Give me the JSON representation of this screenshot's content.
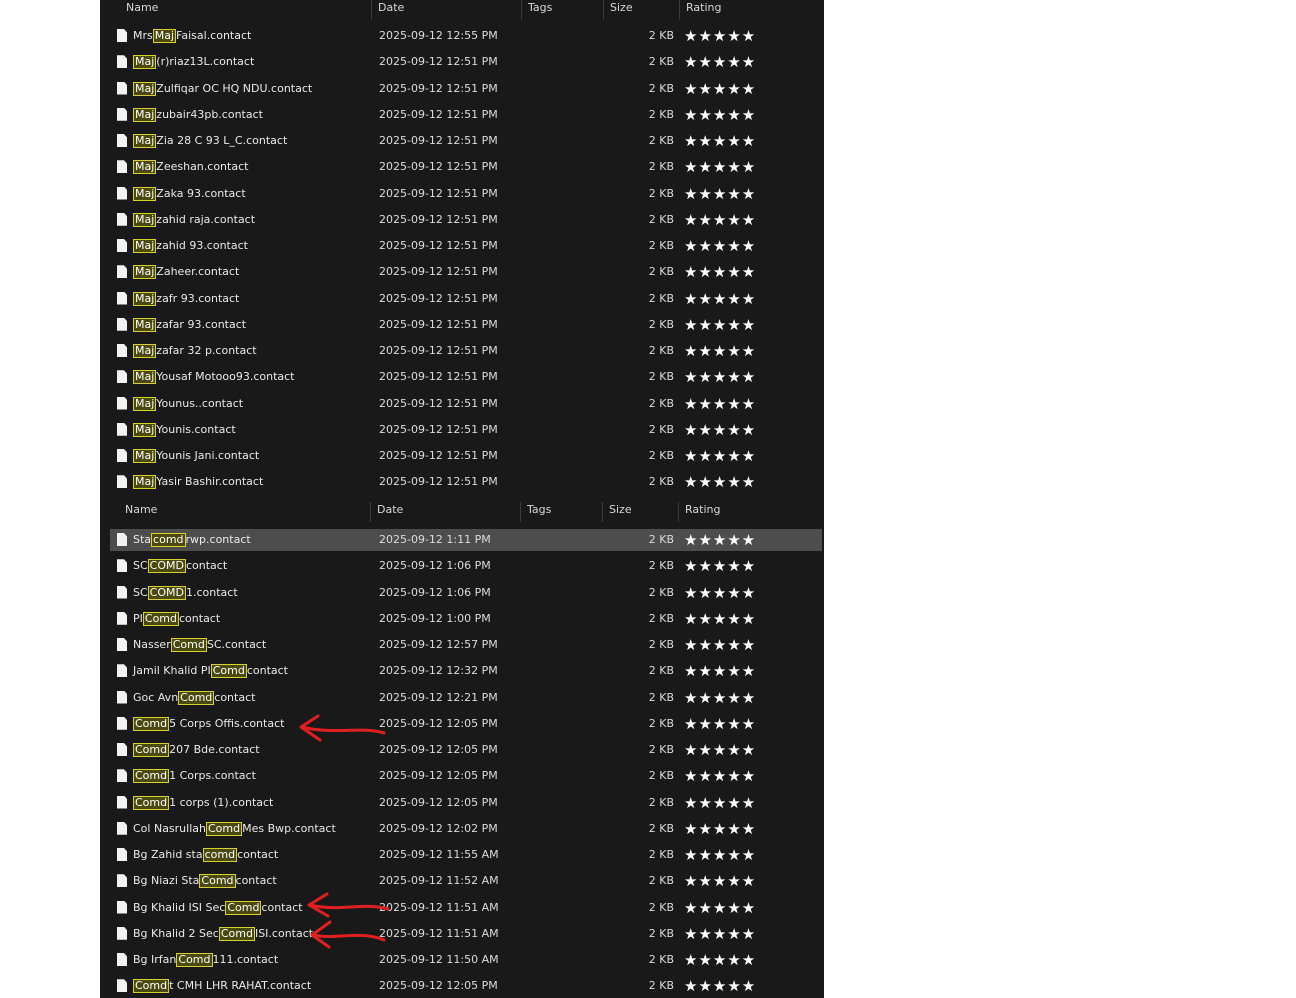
{
  "columns": {
    "name": "Name",
    "date": "Date",
    "tags": "Tags",
    "size": "Size",
    "rating": "Rating"
  },
  "colors": {
    "highlight_border": "#d8d130",
    "highlight_bg": "#4a4a10",
    "annotation_arrow": "#e02020",
    "panel_bg": "#191919"
  },
  "icons": {
    "file": "file-icon",
    "star": "star-icon"
  },
  "top_list": {
    "rows": [
      {
        "pre": "Mrs",
        "hl": "Maj",
        "post": "Faisal.contact",
        "date": "2025-09-12 12:55 PM",
        "size": "2 KB",
        "rating": "★★★★★"
      },
      {
        "pre": "",
        "hl": "Maj",
        "post": "(r)riaz13L.contact",
        "date": "2025-09-12 12:51 PM",
        "size": "2 KB",
        "rating": "★★★★★"
      },
      {
        "pre": "",
        "hl": "Maj",
        "post": "Zulfiqar OC HQ NDU.contact",
        "date": "2025-09-12 12:51 PM",
        "size": "2 KB",
        "rating": "★★★★★"
      },
      {
        "pre": "",
        "hl": "Maj",
        "post": "zubair43pb.contact",
        "date": "2025-09-12 12:51 PM",
        "size": "2 KB",
        "rating": "★★★★★"
      },
      {
        "pre": "",
        "hl": "Maj",
        "post": "Zia 28 C 93 L_C.contact",
        "date": "2025-09-12 12:51 PM",
        "size": "2 KB",
        "rating": "★★★★★"
      },
      {
        "pre": "",
        "hl": "Maj",
        "post": "Zeeshan.contact",
        "date": "2025-09-12 12:51 PM",
        "size": "2 KB",
        "rating": "★★★★★"
      },
      {
        "pre": "",
        "hl": "Maj",
        "post": "Zaka 93.contact",
        "date": "2025-09-12 12:51 PM",
        "size": "2 KB",
        "rating": "★★★★★"
      },
      {
        "pre": "",
        "hl": "Maj",
        "post": "zahid raja.contact",
        "date": "2025-09-12 12:51 PM",
        "size": "2 KB",
        "rating": "★★★★★"
      },
      {
        "pre": "",
        "hl": "Maj",
        "post": "zahid 93.contact",
        "date": "2025-09-12 12:51 PM",
        "size": "2 KB",
        "rating": "★★★★★"
      },
      {
        "pre": "",
        "hl": "Maj",
        "post": "Zaheer.contact",
        "date": "2025-09-12 12:51 PM",
        "size": "2 KB",
        "rating": "★★★★★"
      },
      {
        "pre": "",
        "hl": "Maj",
        "post": "zafr 93.contact",
        "date": "2025-09-12 12:51 PM",
        "size": "2 KB",
        "rating": "★★★★★"
      },
      {
        "pre": "",
        "hl": "Maj",
        "post": "zafar 93.contact",
        "date": "2025-09-12 12:51 PM",
        "size": "2 KB",
        "rating": "★★★★★"
      },
      {
        "pre": "",
        "hl": "Maj",
        "post": "zafar 32 p.contact",
        "date": "2025-09-12 12:51 PM",
        "size": "2 KB",
        "rating": "★★★★★"
      },
      {
        "pre": "",
        "hl": "Maj",
        "post": "Yousaf Motooo93.contact",
        "date": "2025-09-12 12:51 PM",
        "size": "2 KB",
        "rating": "★★★★★"
      },
      {
        "pre": "",
        "hl": "Maj",
        "post": "Younus..contact",
        "date": "2025-09-12 12:51 PM",
        "size": "2 KB",
        "rating": "★★★★★"
      },
      {
        "pre": "",
        "hl": "Maj",
        "post": "Younis.contact",
        "date": "2025-09-12 12:51 PM",
        "size": "2 KB",
        "rating": "★★★★★"
      },
      {
        "pre": "",
        "hl": "Maj",
        "post": "Younis Jani.contact",
        "date": "2025-09-12 12:51 PM",
        "size": "2 KB",
        "rating": "★★★★★"
      },
      {
        "pre": "",
        "hl": "Maj",
        "post": "Yasir Bashir.contact",
        "date": "2025-09-12 12:51 PM",
        "size": "2 KB",
        "rating": "★★★★★"
      }
    ]
  },
  "bottom_list": {
    "rows": [
      {
        "pre": "Sta",
        "hl": "comd",
        "post": "rwp.contact",
        "date": "2025-09-12 1:11 PM",
        "size": "2 KB",
        "rating": "★★★★★",
        "selected": true
      },
      {
        "pre": "SC",
        "hl": "COMD",
        "post": "contact",
        "date": "2025-09-12 1:06 PM",
        "size": "2 KB",
        "rating": "★★★★★"
      },
      {
        "pre": "SC",
        "hl": "COMD",
        "post": "1.contact",
        "date": "2025-09-12 1:06 PM",
        "size": "2 KB",
        "rating": "★★★★★"
      },
      {
        "pre": "PI",
        "hl": "Comd",
        "post": "contact",
        "date": "2025-09-12 1:00 PM",
        "size": "2 KB",
        "rating": "★★★★★"
      },
      {
        "pre": "Nasser",
        "hl": "Comd",
        "post": "SC.contact",
        "date": "2025-09-12 12:57 PM",
        "size": "2 KB",
        "rating": "★★★★★"
      },
      {
        "pre": "Jamil Khalid PI",
        "hl": "Comd",
        "post": "contact",
        "date": "2025-09-12 12:32 PM",
        "size": "2 KB",
        "rating": "★★★★★"
      },
      {
        "pre": "Goc Avn",
        "hl": "Comd",
        "post": "contact",
        "date": "2025-09-12 12:21 PM",
        "size": "2 KB",
        "rating": "★★★★★"
      },
      {
        "pre": "",
        "hl": "Comd",
        "post": "5 Corps Offis.contact",
        "date": "2025-09-12 12:05 PM",
        "size": "2 KB",
        "rating": "★★★★★"
      },
      {
        "pre": "",
        "hl": "Comd",
        "post": "207 Bde.contact",
        "date": "2025-09-12 12:05 PM",
        "size": "2 KB",
        "rating": "★★★★★"
      },
      {
        "pre": "",
        "hl": "Comd",
        "post": "1 Corps.contact",
        "date": "2025-09-12 12:05 PM",
        "size": "2 KB",
        "rating": "★★★★★"
      },
      {
        "pre": "",
        "hl": "Comd",
        "post": "1 corps (1).contact",
        "date": "2025-09-12 12:05 PM",
        "size": "2 KB",
        "rating": "★★★★★"
      },
      {
        "pre": "Col Nasrullah",
        "hl": "Comd",
        "post": "Mes Bwp.contact",
        "date": "2025-09-12 12:02 PM",
        "size": "2 KB",
        "rating": "★★★★★"
      },
      {
        "pre": "Bg Zahid sta",
        "hl": "comd",
        "post": "contact",
        "date": "2025-09-12 11:55 AM",
        "size": "2 KB",
        "rating": "★★★★★"
      },
      {
        "pre": "Bg Niazi Sta",
        "hl": "Comd",
        "post": "contact",
        "date": "2025-09-12 11:52 AM",
        "size": "2 KB",
        "rating": "★★★★★"
      },
      {
        "pre": "Bg Khalid ISI Sec",
        "hl": "Comd",
        "post": "contact",
        "date": "2025-09-12 11:51 AM",
        "size": "2 KB",
        "rating": "★★★★★"
      },
      {
        "pre": "Bg Khalid 2 Sec",
        "hl": "Comd",
        "post": "ISI.contact",
        "date": "2025-09-12 11:51 AM",
        "size": "2 KB",
        "rating": "★★★★★"
      },
      {
        "pre": "Bg Irfan",
        "hl": "Comd",
        "post": "111.contact",
        "date": "2025-09-12 11:50 AM",
        "size": "2 KB",
        "rating": "★★★★★"
      },
      {
        "pre": "",
        "hl": "Comd",
        "post": "t CMH LHR RAHAT.contact",
        "date": "2025-09-12 12:05 PM",
        "size": "2 KB",
        "rating": "★★★★★"
      }
    ]
  }
}
